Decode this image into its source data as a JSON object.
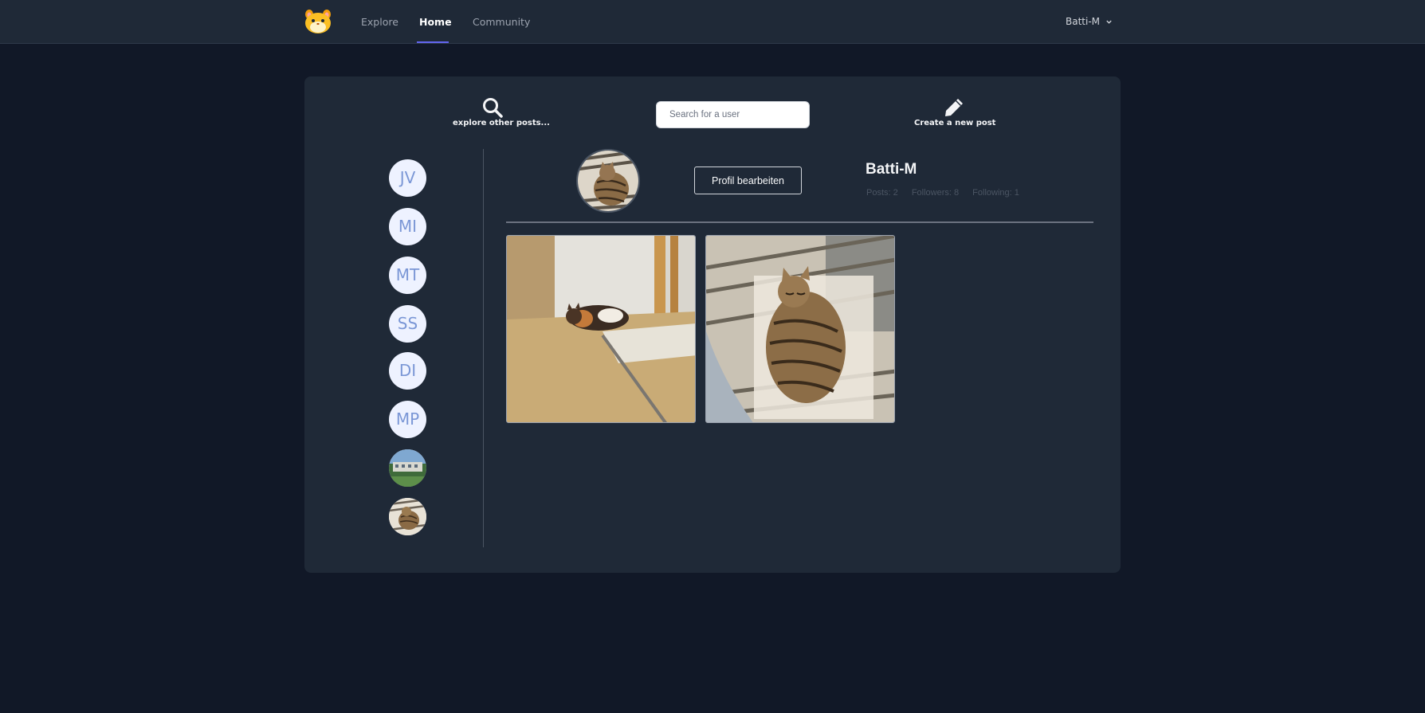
{
  "nav": {
    "links": [
      {
        "label": "Explore",
        "active": false
      },
      {
        "label": "Home",
        "active": true
      },
      {
        "label": "Community",
        "active": false
      }
    ],
    "user_menu": "Batti-M",
    "accent_color": "#6366f1"
  },
  "toolbar": {
    "explore_label": "explore other posts...",
    "search_placeholder": "Search for a user",
    "create_label": "Create a new post"
  },
  "sidebar": {
    "users": [
      {
        "initials": "JV"
      },
      {
        "initials": "MI"
      },
      {
        "initials": "MT"
      },
      {
        "initials": "SS"
      },
      {
        "initials": "DI"
      },
      {
        "initials": "MP"
      },
      {
        "initials": ""
      },
      {
        "initials": ""
      }
    ]
  },
  "profile": {
    "username": "Batti-M",
    "edit_button": "Profil bearbeiten",
    "posts": "Posts: 2",
    "followers": "Followers: 8",
    "following": "Following: 1"
  },
  "colors": {
    "page_bg": "#111827",
    "card_bg": "#1f2937",
    "avatar_bg": "#eef2ff",
    "avatar_text": "#7b97d6"
  }
}
